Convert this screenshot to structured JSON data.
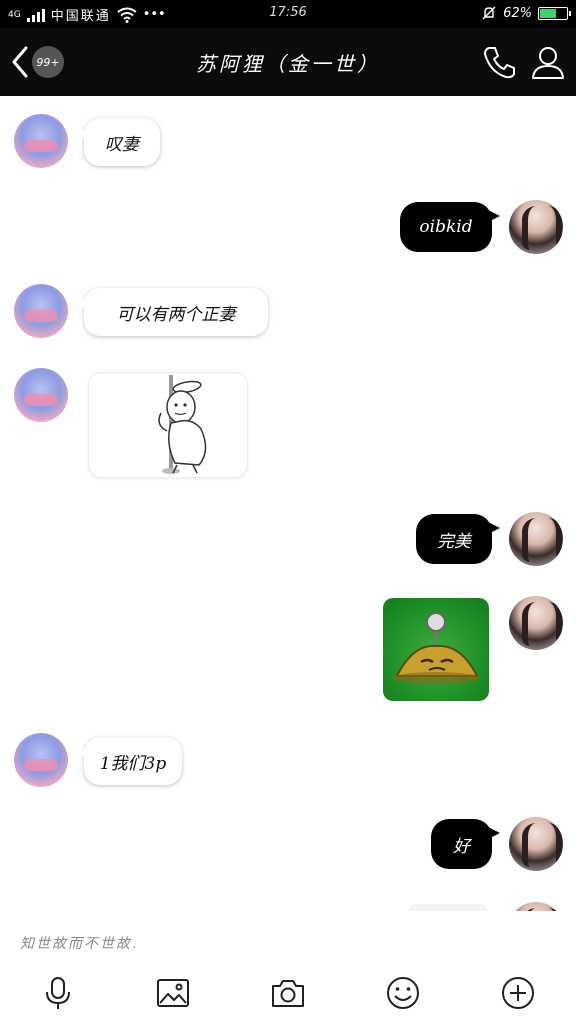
{
  "status_bar": {
    "network": "4G",
    "carrier": "中国联通",
    "more": "•••",
    "time": "17:56",
    "battery": "62%",
    "battery_level": 0.62
  },
  "header": {
    "unread_badge": "99+",
    "title": "苏阿狸（金一世）"
  },
  "messages": [
    {
      "from": "them",
      "type": "text",
      "text": "叹妻"
    },
    {
      "from": "me",
      "type": "text",
      "text": "oibkid"
    },
    {
      "from": "them",
      "type": "text",
      "text": "可以有两个正妻"
    },
    {
      "from": "them",
      "type": "sticker",
      "sticker": "rabbit-pole-sticker"
    },
    {
      "from": "me",
      "type": "text",
      "text": "完美"
    },
    {
      "from": "me",
      "type": "image",
      "image": "potato-mine-image"
    },
    {
      "from": "them",
      "type": "text",
      "text": "1我们3p"
    },
    {
      "from": "me",
      "type": "text",
      "text": "好"
    }
  ],
  "input": {
    "text": "知世故而不世故."
  },
  "toolbar": [
    "mic-icon",
    "image-icon",
    "camera-icon",
    "emoji-icon",
    "plus-icon"
  ],
  "colors": {
    "bar_background": "#0b0b0b",
    "outgoing_bubble": "#000000",
    "incoming_bubble": "#ffffff",
    "battery_fill": "#3ad46a"
  }
}
